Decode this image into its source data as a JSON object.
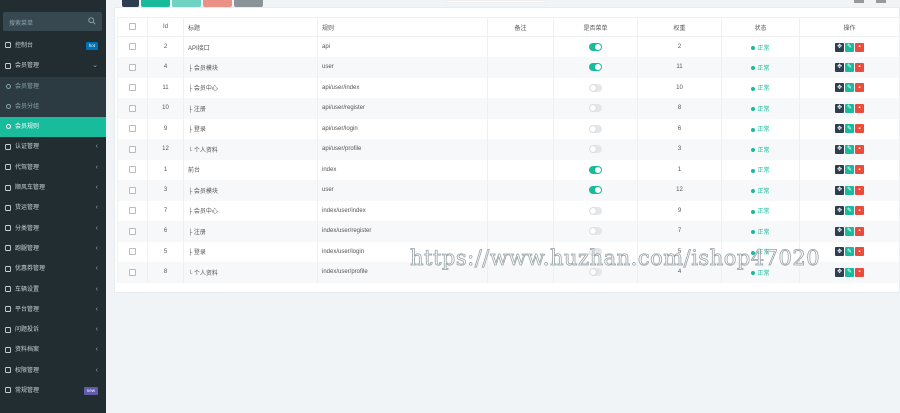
{
  "sidebar": {
    "search_placeholder": "搜索菜单",
    "menu": [
      {
        "label": "控制台",
        "icon": "dashboard-icon",
        "badge": "hot",
        "badge_color": "#0073b7"
      },
      {
        "label": "会员管理",
        "icon": "user-icon",
        "expanded": true,
        "children": [
          {
            "label": "会员管理",
            "active": false
          },
          {
            "label": "会员分组",
            "active": false
          },
          {
            "label": "会员规则",
            "active": true
          }
        ]
      },
      {
        "label": "认证管理",
        "icon": "id-card-icon"
      },
      {
        "label": "代驾管理",
        "icon": "car-icon"
      },
      {
        "label": "顺风车管理",
        "icon": "car-icon"
      },
      {
        "label": "货运管理",
        "icon": "truck-icon"
      },
      {
        "label": "分类管理",
        "icon": "category-icon"
      },
      {
        "label": "跑腿管理",
        "icon": "run-icon"
      },
      {
        "label": "优惠券管理",
        "icon": "coupon-icon"
      },
      {
        "label": "车辆设置",
        "icon": "settings-icon"
      },
      {
        "label": "平台管理",
        "icon": "platform-icon"
      },
      {
        "label": "问题投诉",
        "icon": "complaint-icon"
      },
      {
        "label": "资料档案",
        "icon": "archive-icon"
      },
      {
        "label": "权限管理",
        "icon": "lock-icon"
      },
      {
        "label": "常规管理",
        "icon": "gear-icon",
        "badge": "new",
        "badge_color": "#605ca8"
      }
    ]
  },
  "table": {
    "headers": [
      "",
      "Id",
      "标题",
      "规则",
      "备注",
      "是否菜单",
      "权重",
      "状态",
      "操作"
    ],
    "rows": [
      {
        "id": "2",
        "title": "API接口",
        "rule": "api",
        "remark": "",
        "menu": true,
        "weight": "2",
        "status": "正常"
      },
      {
        "id": "4",
        "title": "├ 会员模块",
        "rule": "user",
        "remark": "",
        "menu": true,
        "weight": "11",
        "status": "正常"
      },
      {
        "id": "11",
        "title": "├ 会员中心",
        "rule": "api/user/index",
        "remark": "",
        "menu": false,
        "weight": "10",
        "status": "正常"
      },
      {
        "id": "10",
        "title": "├ 注册",
        "rule": "api/user/register",
        "remark": "",
        "menu": false,
        "weight": "8",
        "status": "正常"
      },
      {
        "id": "9",
        "title": "├ 登录",
        "rule": "api/user/login",
        "remark": "",
        "menu": false,
        "weight": "6",
        "status": "正常"
      },
      {
        "id": "12",
        "title": "└ 个人资料",
        "rule": "api/user/profile",
        "remark": "",
        "menu": false,
        "weight": "3",
        "status": "正常"
      },
      {
        "id": "1",
        "title": "前台",
        "rule": "index",
        "remark": "",
        "menu": true,
        "weight": "1",
        "status": "正常"
      },
      {
        "id": "3",
        "title": "├ 会员模块",
        "rule": "user",
        "remark": "",
        "menu": true,
        "weight": "12",
        "status": "正常"
      },
      {
        "id": "7",
        "title": "├ 会员中心",
        "rule": "index/user/index",
        "remark": "",
        "menu": false,
        "weight": "9",
        "status": "正常"
      },
      {
        "id": "6",
        "title": "├ 注册",
        "rule": "index/user/register",
        "remark": "",
        "menu": false,
        "weight": "7",
        "status": "正常"
      },
      {
        "id": "5",
        "title": "├ 登录",
        "rule": "index/user/login",
        "remark": "",
        "menu": false,
        "weight": "5",
        "status": "正常"
      },
      {
        "id": "8",
        "title": "└ 个人资料",
        "rule": "index/user/profile",
        "remark": "",
        "menu": false,
        "weight": "4",
        "status": "正常"
      }
    ]
  },
  "watermark": "https://www.huzhan.com/ishop47020",
  "colors": {
    "sidebar_bg": "#222d32",
    "accent": "#18bc9c",
    "danger": "#e74c3c",
    "dark": "#2c3e50"
  }
}
